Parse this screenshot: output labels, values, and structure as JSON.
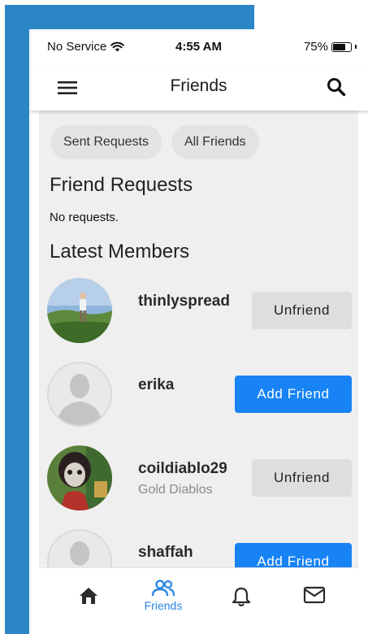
{
  "status_bar": {
    "carrier": "No Service",
    "time": "4:55 AM",
    "battery": "75%",
    "battery_level": 0.75
  },
  "app_bar": {
    "title": "Friends",
    "menu_icon": "hamburger-menu-icon",
    "search_icon": "search-icon"
  },
  "chips": [
    {
      "label": "Sent Requests"
    },
    {
      "label": "All Friends"
    }
  ],
  "friend_requests": {
    "title": "Friend Requests",
    "empty_text": "No requests."
  },
  "latest_members": {
    "title": "Latest Members",
    "items": [
      {
        "name": "thinlyspread",
        "subtitle": "",
        "action": "Unfriend"
      },
      {
        "name": "erika",
        "subtitle": "",
        "action": "Add Friend"
      },
      {
        "name": "coildiablo29",
        "subtitle": "Gold Diablos",
        "action": "Unfriend"
      },
      {
        "name": "shaffah",
        "subtitle": "",
        "action": "Add Friend"
      }
    ]
  },
  "bottom_nav": {
    "items": [
      {
        "icon": "home-icon",
        "label": ""
      },
      {
        "icon": "friends-icon",
        "label": "Friends",
        "active": true
      },
      {
        "icon": "bell-icon",
        "label": ""
      },
      {
        "icon": "mail-icon",
        "label": ""
      }
    ]
  },
  "colors": {
    "accent": "#1883f4",
    "nav_active": "#2a86e0",
    "background_strip": "#2a86c5",
    "content_bg": "#efefef"
  }
}
